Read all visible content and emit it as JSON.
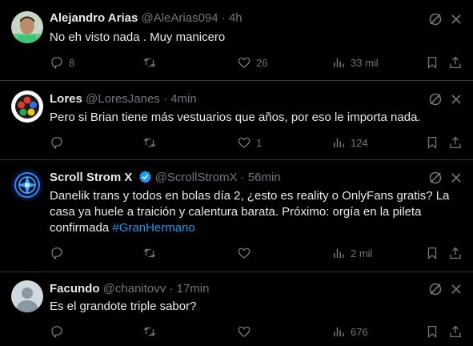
{
  "tweets": [
    {
      "name": "Alejandro Arias",
      "handle": "@AleArias094",
      "separator": "·",
      "time": "4h",
      "verified": false,
      "text": "No eh visto nada . Muy manicero",
      "hashtag": "",
      "replies": "8",
      "retweets": "",
      "likes": "26",
      "views": "33 mil"
    },
    {
      "name": "Lores",
      "handle": "@LoresJanes",
      "separator": "·",
      "time": "4min",
      "verified": false,
      "text": "Pero si Brian tiene más vestuarios que años, por eso le importa nada.",
      "hashtag": "",
      "replies": "",
      "retweets": "",
      "likes": "1",
      "views": "124"
    },
    {
      "name": "Scroll Strom X",
      "handle": "@ScrollStromX",
      "separator": "·",
      "time": "56min",
      "verified": true,
      "text": "Danelik trans y todos en bolas día 2, ¿esto es reality o OnlyFans gratis? La casa ya huele a traición y calentura barata. Próximo: orgía en la pileta confirmada",
      "hashtag": "#GranHermano",
      "replies": "",
      "retweets": "",
      "likes": "",
      "views": "2 mil"
    },
    {
      "name": "Facundo",
      "handle": "@chanitovv",
      "separator": "·",
      "time": "17min",
      "verified": false,
      "text": "Es el grandote triple sabor?",
      "hashtag": "",
      "replies": "",
      "retweets": "",
      "likes": "",
      "views": "676"
    }
  ],
  "icons": {
    "reply": "reply-icon",
    "retweet": "retweet-icon",
    "like": "heart-icon",
    "views": "views-icon",
    "bookmark": "bookmark-icon",
    "share": "share-icon",
    "grok": "grok-icon",
    "more": "more-icon",
    "verified": "verified-badge-icon"
  },
  "colors": {
    "background": "#000000",
    "text": "#e7e9ea",
    "secondary": "#71767b",
    "link": "#1d9bf0",
    "divider": "#2f3336"
  }
}
